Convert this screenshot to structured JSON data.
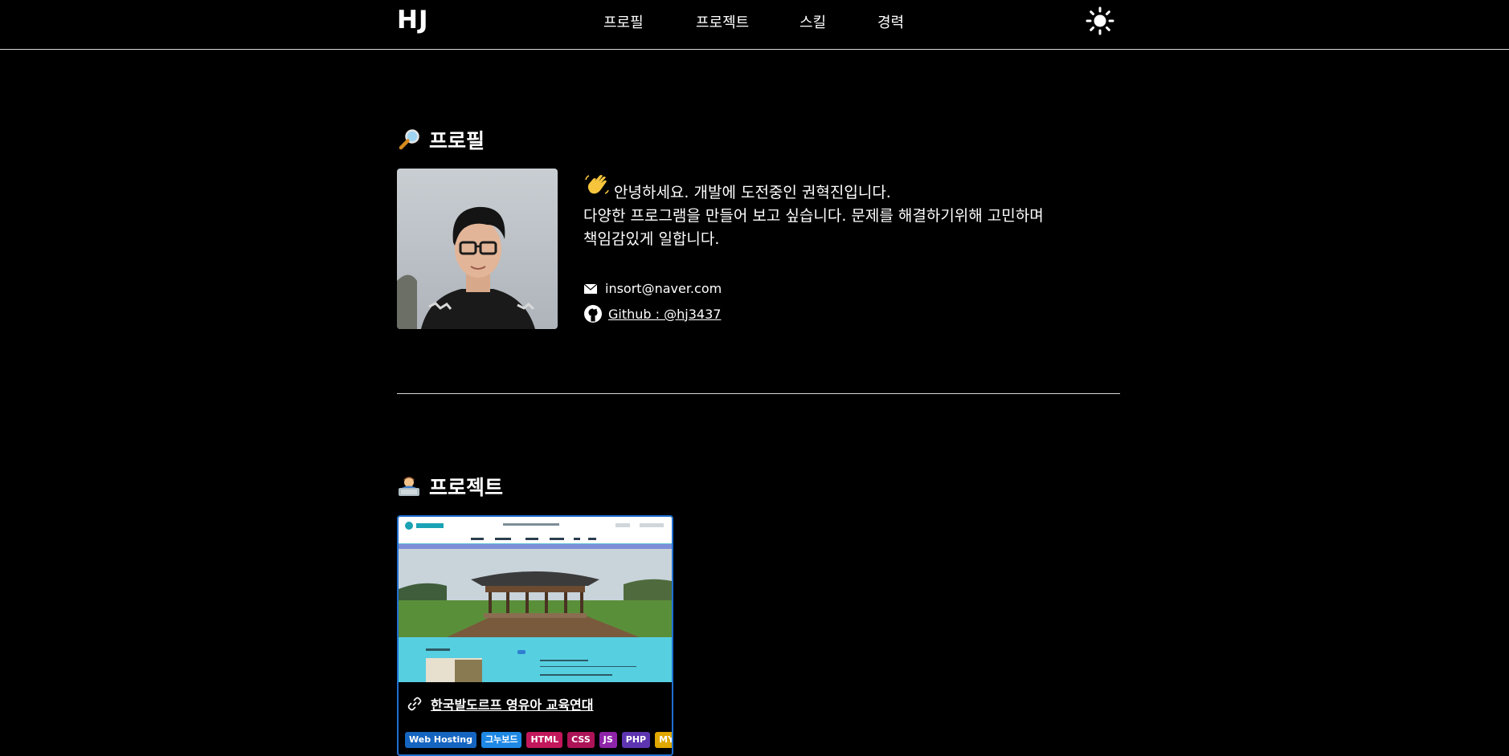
{
  "header": {
    "logo": "HJ",
    "nav": [
      {
        "label": "프로필"
      },
      {
        "label": "프로젝트"
      },
      {
        "label": "스킬"
      },
      {
        "label": "경력"
      }
    ],
    "theme_icon": "sun-icon"
  },
  "profile": {
    "section_title": "프로필",
    "section_icon": "magnifier-icon",
    "greeting_icon": "waving-hand-icon",
    "intro_line1": "안녕하세요. 개발에 도전중인 권혁진입니다.",
    "intro_line2": "다양한 프로그램을 만들어 보고 싶습니다. 문제를 해결하기위해 고민하며",
    "intro_line3": "책임감있게 일합니다.",
    "email_icon": "envelope-icon",
    "email": "insort@naver.com",
    "github_icon": "github-icon",
    "github_label": "Github : @hj3437"
  },
  "projects": {
    "section_title": "프로젝트",
    "section_icon": "technologist-icon",
    "items": [
      {
        "title": "한국발도르프 영유아 교육연대",
        "link_icon": "link-icon",
        "tags": [
          {
            "label": "Web Hosting",
            "color": "#1565c0"
          },
          {
            "label": "그누보드",
            "color": "#1e88e5"
          },
          {
            "label": "HTML",
            "color": "#c2185b"
          },
          {
            "label": "CSS",
            "color": "#ad1457"
          },
          {
            "label": "JS",
            "color": "#8e24aa"
          },
          {
            "label": "PHP",
            "color": "#5e35b1"
          },
          {
            "label": "MYSQL",
            "color": "#e0a800"
          }
        ]
      }
    ]
  },
  "colors": {
    "background": "#000000",
    "text": "#ffffff",
    "divider": "#d9d9d9",
    "card_border": "#1f6fd1"
  }
}
